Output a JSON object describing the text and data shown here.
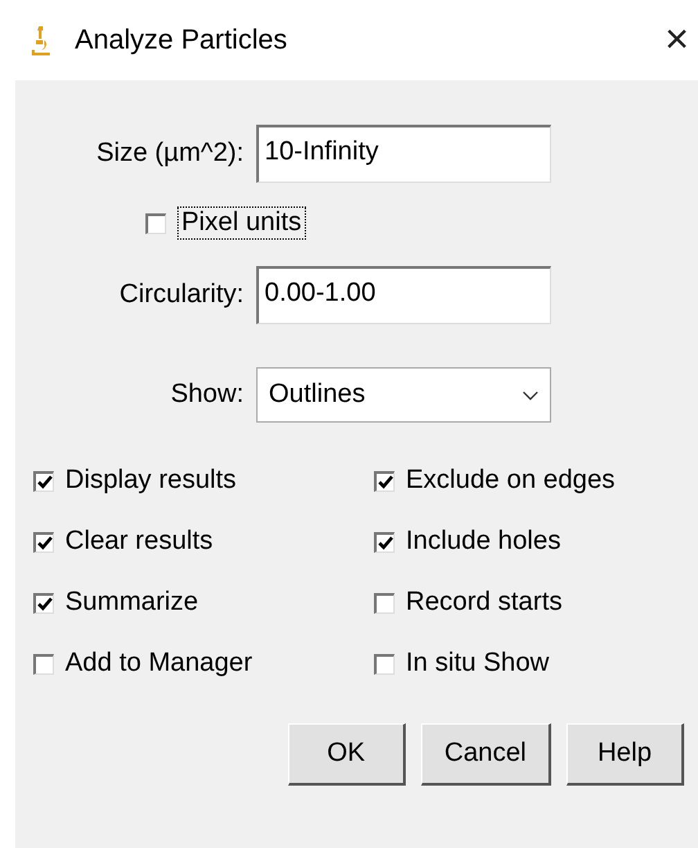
{
  "window": {
    "title": "Analyze Particles",
    "close": "×"
  },
  "fields": [
    {
      "kind": "text",
      "label": "Size (µm^2):",
      "value": "10-Infinity"
    },
    {
      "kind": "checkbox",
      "label": "Pixel units",
      "checked": false,
      "focused": true
    },
    {
      "kind": "text",
      "label": "Circularity:",
      "value": "0.00-1.00"
    },
    {
      "kind": "select",
      "label": "Show:",
      "value": "Outlines"
    }
  ],
  "options": [
    {
      "label": "Display results",
      "checked": true
    },
    {
      "label": "Exclude on edges",
      "checked": true
    },
    {
      "label": "Clear results",
      "checked": true
    },
    {
      "label": "Include holes",
      "checked": true
    },
    {
      "label": "Summarize",
      "checked": true
    },
    {
      "label": "Record starts",
      "checked": false
    },
    {
      "label": "Add to Manager",
      "checked": false
    },
    {
      "label": "In situ Show",
      "checked": false
    }
  ],
  "buttons": [
    "OK",
    "Cancel",
    "Help"
  ]
}
